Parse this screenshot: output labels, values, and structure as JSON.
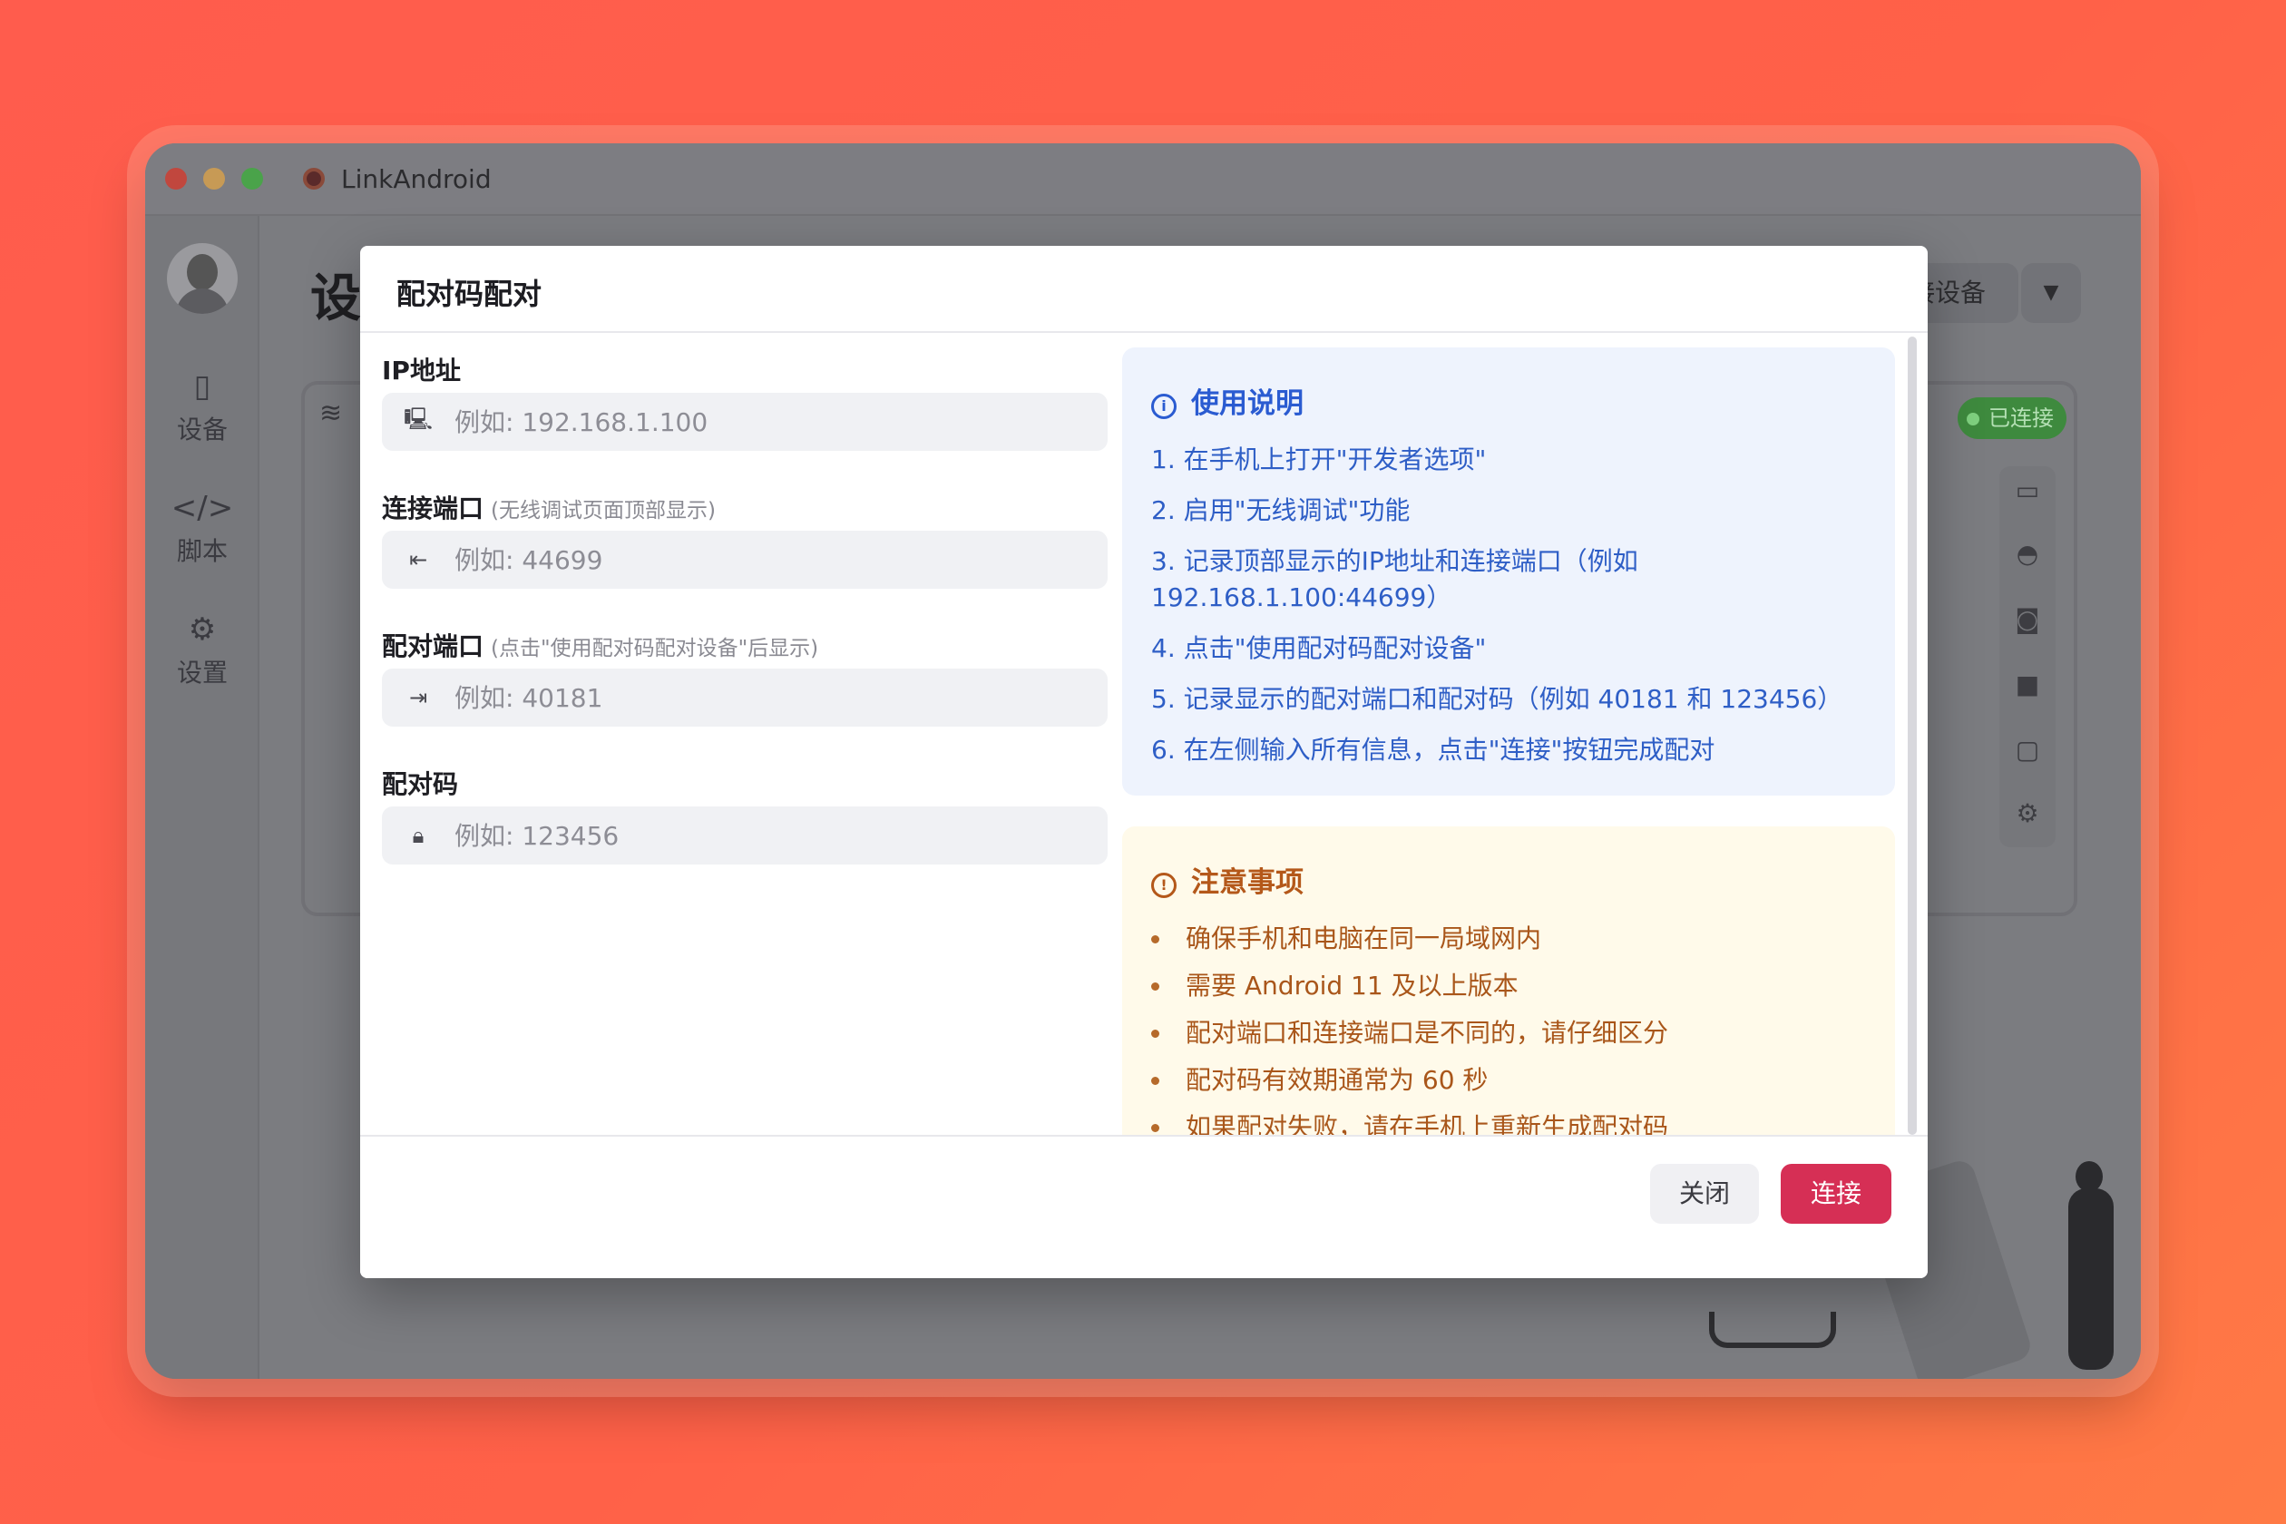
{
  "window": {
    "title": "LinkAndroid"
  },
  "sidebar": {
    "items": [
      {
        "label": "设备",
        "icon": "device-icon"
      },
      {
        "label": "脚本",
        "icon": "code-icon"
      },
      {
        "label": "设置",
        "icon": "gear-icon"
      }
    ]
  },
  "main": {
    "page_title": "设",
    "top_button_label": "接设备",
    "status_badge": "已连接"
  },
  "dialog": {
    "title": "配对码配对",
    "fields": [
      {
        "label": "IP地址",
        "hint": "",
        "placeholder": "例如: 192.168.1.100",
        "value": "",
        "icon": "monitor-icon"
      },
      {
        "label": "连接端口",
        "hint": "(无线调试页面顶部显示)",
        "placeholder": "例如: 44699",
        "value": "",
        "icon": "login-icon"
      },
      {
        "label": "配对端口",
        "hint": "(点击\"使用配对码配对设备\"后显示)",
        "placeholder": "例如: 40181",
        "value": "",
        "icon": "logout-icon"
      },
      {
        "label": "配对码",
        "hint": "",
        "placeholder": "例如: 123456",
        "value": "",
        "icon": "lock-icon"
      }
    ],
    "usage": {
      "title": "使用说明",
      "steps": [
        "1. 在手机上打开\"开发者选项\"",
        "2. 启用\"无线调试\"功能",
        "3. 记录顶部显示的IP地址和连接端口（例如 192.168.1.100:44699）",
        "4. 点击\"使用配对码配对设备\"",
        "5. 记录显示的配对端口和配对码（例如 40181 和 123456）",
        "6. 在左侧输入所有信息，点击\"连接\"按钮完成配对"
      ]
    },
    "notice": {
      "title": "注意事项",
      "items": [
        "确保手机和电脑在同一局域网内",
        "需要 Android 11 及以上版本",
        "配对端口和连接端口是不同的，请仔细区分",
        "配对码有效期通常为 60 秒",
        "如果配对失败，请在手机上重新生成配对码"
      ]
    },
    "buttons": {
      "close": "关闭",
      "connect": "连接"
    }
  },
  "colors": {
    "background": "#ff5c4d",
    "accent": "#d62f55",
    "usage_text": "#2e5ec6",
    "notice_text": "#a9561a",
    "status_green": "#3e8a3e"
  }
}
